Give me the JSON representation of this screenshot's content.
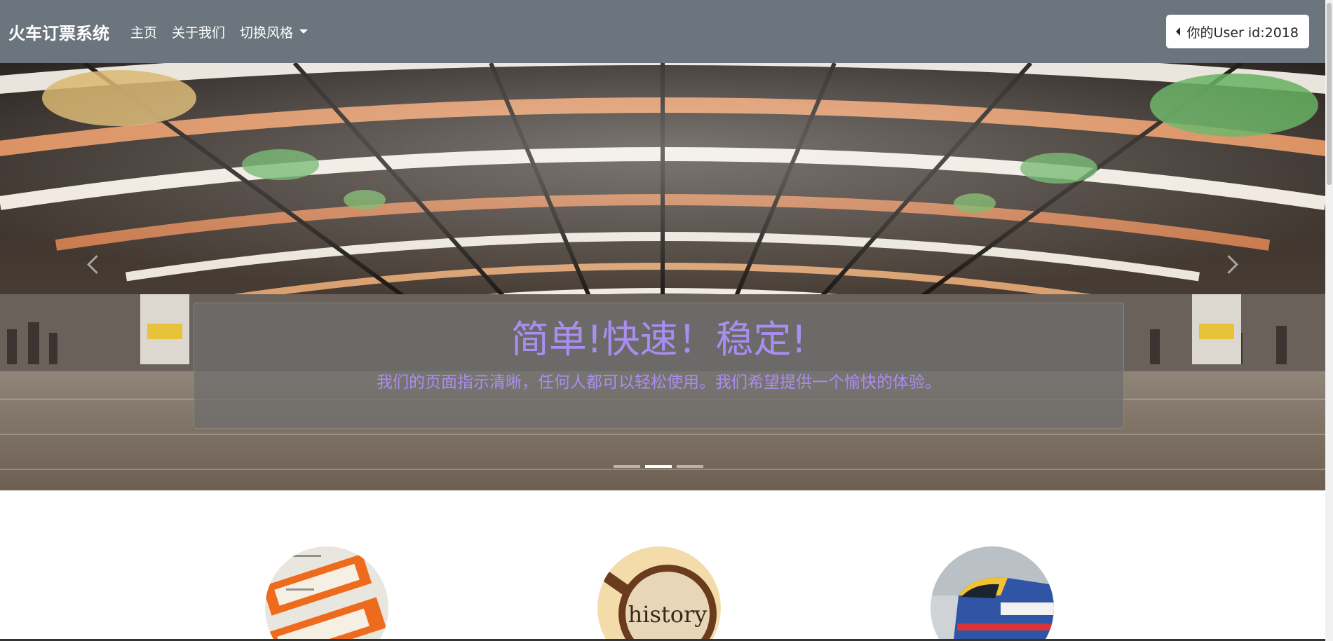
{
  "navbar": {
    "brand": "火车订票系统",
    "links": [
      "主页",
      "关于我们"
    ],
    "dropdown_label": "切换风格",
    "user_button": "你的User id:2018"
  },
  "carousel": {
    "title": "简单!快速！稳定!",
    "text": "我们的页面指示清晰，任何人都可以轻松使用。我们希望提供一个愉快的体验。",
    "slide_count": 3,
    "active_slide": 2,
    "caption_color": "#a98df0"
  },
  "features": [
    {
      "image": "tickets-image"
    },
    {
      "image": "history-magnifier-image",
      "label": "history"
    },
    {
      "image": "train-image"
    }
  ],
  "colors": {
    "navbar_bg": "#6c757d",
    "caption_text": "#a98df0"
  }
}
